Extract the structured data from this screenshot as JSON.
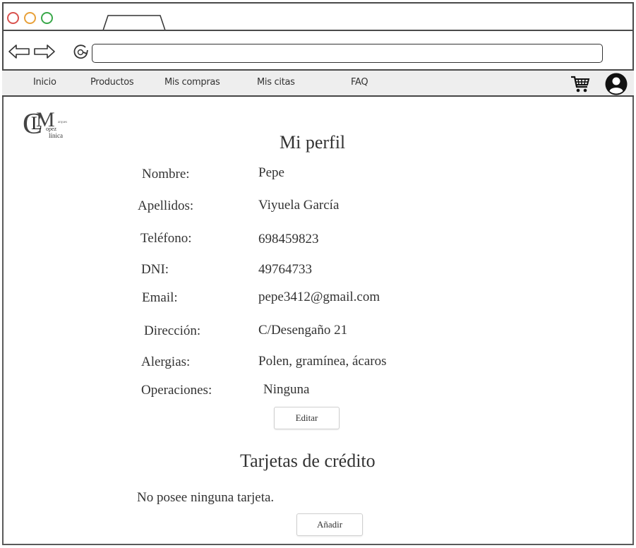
{
  "window": {
    "controls": [
      "close-button",
      "minimize-button",
      "maximize-button"
    ]
  },
  "address_bar": {
    "url": ""
  },
  "nav": {
    "items": [
      {
        "label": "Inicio"
      },
      {
        "label": "Productos"
      },
      {
        "label": "Mis compras"
      },
      {
        "label": "Mis citas"
      },
      {
        "label": "FAQ"
      }
    ],
    "icons": [
      "cart-icon",
      "user-account-icon"
    ]
  },
  "logo": {
    "big_letter_1": "C",
    "big_letter_2": "L",
    "big_letter_3": "M",
    "small_text_1": "opez",
    "small_text_2": "línica",
    "small_text_3": "arques"
  },
  "profile": {
    "title": "Mi perfil",
    "fields": [
      {
        "label": "Nombre:",
        "value": "Pepe"
      },
      {
        "label": "Apellidos:",
        "value": "Viyuela García"
      },
      {
        "label": "Teléfono:",
        "value": "698459823"
      },
      {
        "label": "DNI:",
        "value": "49764733"
      },
      {
        "label": "Email:",
        "value": "pepe3412@gmail.com"
      },
      {
        "label": "Dirección:",
        "value": "C/Desengaño 21"
      },
      {
        "label": "Alergias:",
        "value": "Polen, gramínea, ácaros"
      },
      {
        "label": "Operaciones:",
        "value": "Ninguna"
      }
    ],
    "edit_label": "Editar"
  },
  "cards": {
    "title": "Tarjetas de crédito",
    "empty_message": "No posee ninguna tarjeta.",
    "add_label": "Añadir"
  },
  "colors": {
    "close": "#d9534f",
    "minimize": "#e8a13a",
    "maximize": "#3aa84a",
    "menubar_bg": "#eeeeee",
    "border": "#4a4a4a"
  }
}
